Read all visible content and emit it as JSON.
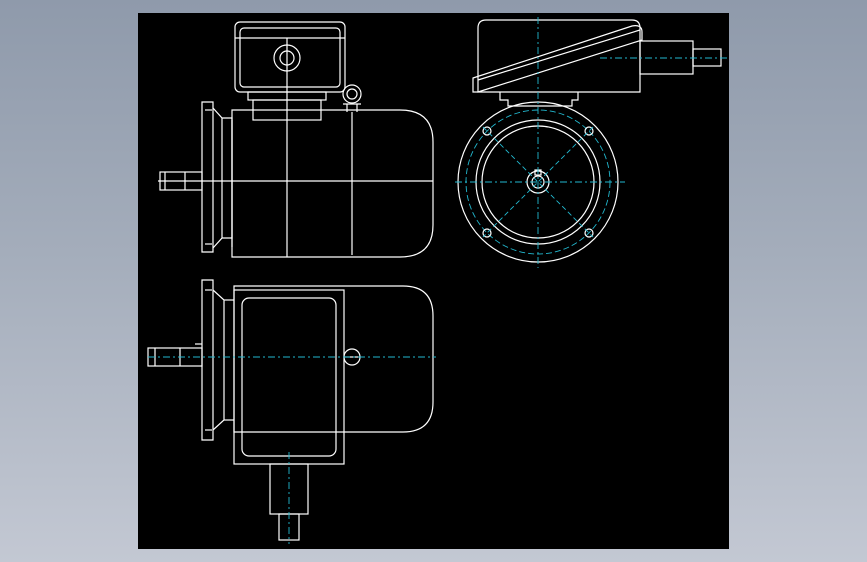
{
  "viewport": {
    "background_top": "#8f9aab",
    "background_bottom": "#c3c8d3",
    "sheet_color": "#000000"
  },
  "drawing": {
    "subject": "electric-motor",
    "line_color": "#ffffff",
    "centerline_color": "#22b8cf",
    "views": [
      "front-view",
      "end-view",
      "top-view"
    ]
  }
}
